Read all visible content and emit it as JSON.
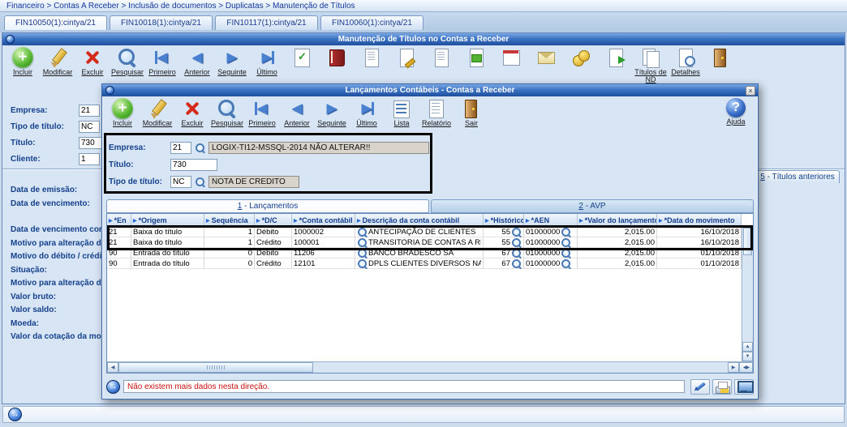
{
  "breadcrumb": "Financeiro > Contas A Receber > Inclusão de documentos > Duplicatas > Manutenção de Títulos",
  "mdi_tabs": [
    "FIN10050(1):cintya/21",
    "FIN10018(1):cintya/21",
    "FIN10117(1):cintya/21",
    "FIN10060(1):cintya/21"
  ],
  "main_window": {
    "title": "Manutenção de Títulos no Contas a Receber",
    "toolbar": [
      {
        "icon": "add",
        "label": "Incluir"
      },
      {
        "icon": "edit",
        "label": "Modificar"
      },
      {
        "icon": "delete",
        "label": "Excluir"
      },
      {
        "icon": "search",
        "label": "Pesquisar"
      },
      {
        "icon": "first",
        "label": "Primeiro"
      },
      {
        "icon": "prev",
        "label": "Anterior"
      },
      {
        "icon": "next",
        "label": "Seguinte"
      },
      {
        "icon": "last",
        "label": "Último"
      },
      {
        "icon": "checklist",
        "label": ""
      },
      {
        "icon": "book",
        "label": ""
      },
      {
        "icon": "doc",
        "label": ""
      },
      {
        "icon": "doc-edit",
        "label": ""
      },
      {
        "icon": "doc",
        "label": ""
      },
      {
        "icon": "doc-green",
        "label": ""
      },
      {
        "icon": "calendar",
        "label": ""
      },
      {
        "icon": "mail",
        "label": ""
      },
      {
        "icon": "money",
        "label": ""
      },
      {
        "icon": "doc-arrow",
        "label": ""
      },
      {
        "icon": "docs",
        "label": "Títulos de ND"
      },
      {
        "icon": "doc-search",
        "label": "Detalhes"
      },
      {
        "icon": "exit",
        "label": ""
      }
    ],
    "fields": [
      {
        "label": "Empresa:",
        "value": "21"
      },
      {
        "label": "Tipo de título:",
        "value": "NC"
      },
      {
        "label": "Título:",
        "value": "730"
      },
      {
        "label": "Cliente:",
        "value": "1"
      }
    ],
    "left_labels": [
      "Data de emissão:",
      "Data de vencimento:",
      "",
      "Data de vencimento com",
      "Motivo para alteração de",
      "Motivo do débito / crédito",
      "Situação:",
      "Motivo para alteração da",
      "Valor bruto:",
      "Valor saldo:",
      "Moeda:",
      "Valor da cotação da moe"
    ],
    "right_tab": "5 - Títulos anteriores"
  },
  "dialog": {
    "title": "Lançamentos Contábeis - Contas a Receber",
    "toolbar": [
      {
        "icon": "add",
        "label": "Incluir"
      },
      {
        "icon": "edit",
        "label": "Modificar"
      },
      {
        "icon": "delete",
        "label": "Excluir"
      },
      {
        "icon": "search",
        "label": "Pesquisar"
      },
      {
        "icon": "first",
        "label": "Primeiro"
      },
      {
        "icon": "prev",
        "label": "Anterior"
      },
      {
        "icon": "next",
        "label": "Seguinte"
      },
      {
        "icon": "last",
        "label": "Último"
      },
      {
        "icon": "list",
        "label": "Lista"
      },
      {
        "icon": "report",
        "label": "Relatório"
      },
      {
        "icon": "exit",
        "label": "Sair"
      }
    ],
    "help_label": "Ajuda",
    "fields": {
      "empresa_label": "Empresa:",
      "empresa_value": "21",
      "empresa_desc": "LOGIX-TI12-MSSQL-2014 NÃO ALTERAR!!",
      "titulo_label": "Título:",
      "titulo_value": "730",
      "tipo_label": "Tipo de título:",
      "tipo_value": "NC",
      "tipo_desc": "NOTA DE CREDITO"
    },
    "tabs": [
      {
        "label": "1 - Lançamentos",
        "active": true
      },
      {
        "label": "2 - AVP",
        "active": false
      }
    ],
    "grid": {
      "columns": [
        "*En",
        "*Origem",
        "Sequência",
        "*D/C",
        "*Conta contábil",
        "Descrição da conta contábil",
        "*Histórico",
        "*AEN",
        "*Valor do lançamento",
        "*Data do movimento"
      ],
      "rows": [
        [
          "21",
          "Baixa do título",
          "1",
          "Débito",
          "1000002",
          "ANTECIPAÇÃO DE CLIENTES",
          "55",
          "01000000",
          "2,015.00",
          "16/10/2018"
        ],
        [
          "21",
          "Baixa do título",
          "1",
          "Crédito",
          "100001",
          "TRANSITORIA DE CONTAS A RECEBER",
          "55",
          "01000000",
          "2,015.00",
          "16/10/2018"
        ],
        [
          "90",
          "Entrada do título",
          "0",
          "Débito",
          "11206",
          "BANCO BRADESCO SA",
          "67",
          "01000000",
          "2,015.00",
          "01/10/2018"
        ],
        [
          "90",
          "Entrada do título",
          "0",
          "Crédito",
          "12101",
          "DPLS CLIENTES DIVERSOS NAC",
          "67",
          "01000000",
          "2,015.00",
          "01/10/2018"
        ]
      ]
    },
    "status_text": "Não existem mais dados nesta direção."
  },
  "colors": {
    "titlebar_top": "#7aa7e4",
    "titlebar_bottom": "#1e4f9e",
    "accent_blue": "#15418c",
    "status_red": "#cc1111",
    "window_bg": "#d7e5f5"
  }
}
